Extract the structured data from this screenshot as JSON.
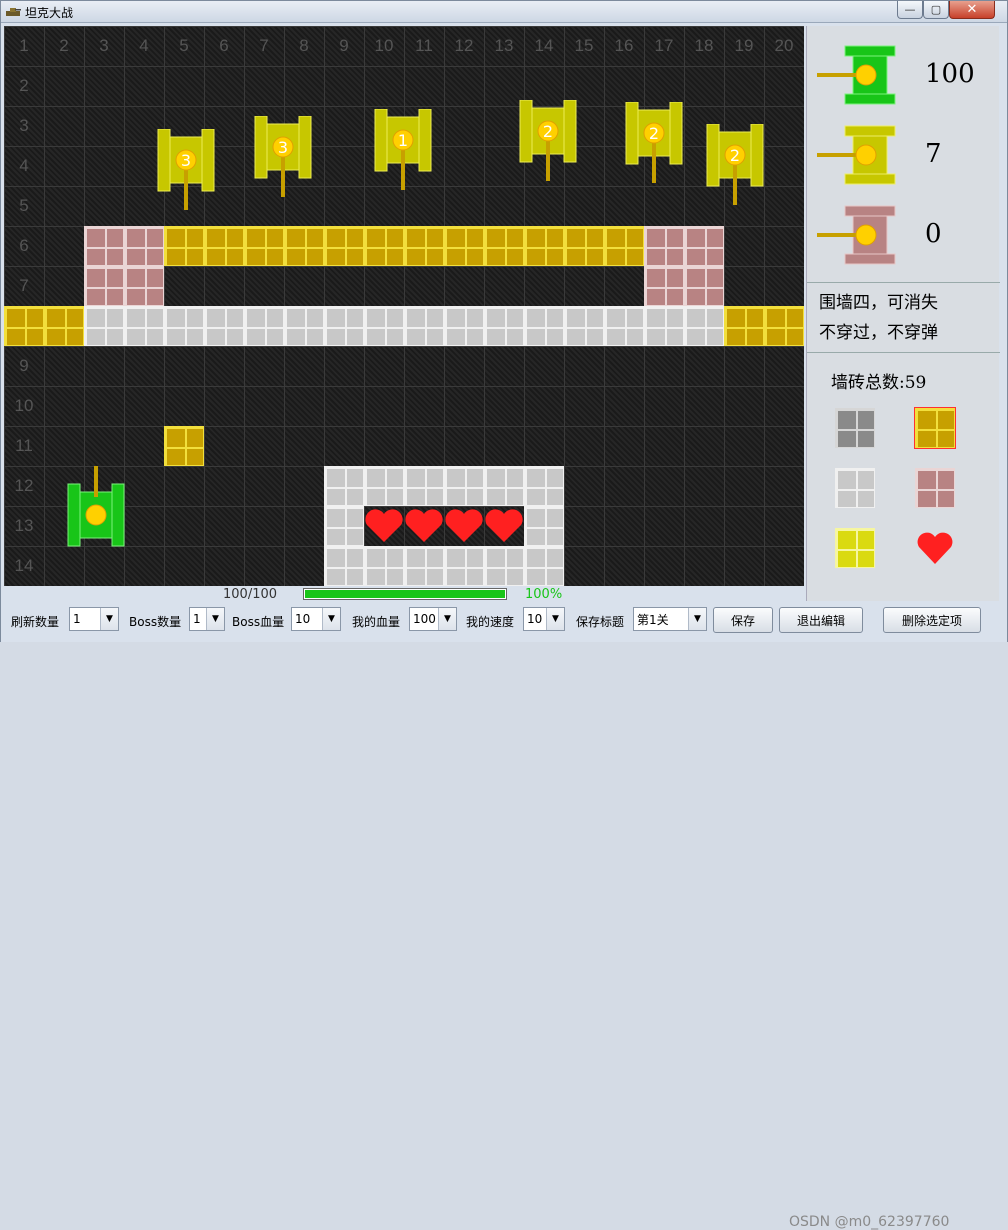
{
  "window": {
    "title": "坦克大战",
    "close_label": "✕",
    "min_label": "—",
    "max_label": "▢"
  },
  "board": {
    "col_labels": [
      "1",
      "2",
      "3",
      "4",
      "5",
      "6",
      "7",
      "8",
      "9",
      "10",
      "11",
      "12",
      "13",
      "14",
      "15",
      "16",
      "17",
      "18",
      "19",
      "20"
    ],
    "row_labels": [
      "2",
      "3",
      "4",
      "5",
      "6",
      "7",
      "9",
      "10",
      "11",
      "12",
      "13",
      "14"
    ],
    "enemy_tank_labels": [
      "3",
      "3",
      "1",
      "2",
      "2",
      "2"
    ],
    "player_hp_text": "100/100",
    "player_hp_fraction": 1.0,
    "player_hp_percent": "100%",
    "colors": {
      "gold": "#c7a000",
      "pink": "#b88383",
      "silver": "#c8c8c8",
      "player": "#18c518",
      "enemy": "#c7c700",
      "heart": "#ff2020"
    }
  },
  "side": {
    "player_count": "100",
    "enemy_count": "7",
    "boss_count": "0",
    "wall_desc_line1": "围墙四，可消失",
    "wall_desc_line2": "不穿过，不穿弹",
    "brick_total_label": "墙砖总数:",
    "brick_total_value": "59"
  },
  "bottom": {
    "refresh_label": "刷新数量",
    "refresh_value": "1",
    "boss_count_label": "Boss数量",
    "boss_count_value": "1",
    "boss_hp_label": "Boss血量",
    "boss_hp_value": "10",
    "my_hp_label": "我的血量",
    "my_hp_value": "100",
    "my_speed_label": "我的速度",
    "my_speed_value": "10",
    "save_title_label": "保存标题",
    "save_title_value": "第1关",
    "save_button": "保存",
    "exit_edit_button": "退出编辑",
    "delete_button": "删除选定项",
    "dropdown_arrow": "▼"
  },
  "watermark": "OSDN @m0_62397760"
}
